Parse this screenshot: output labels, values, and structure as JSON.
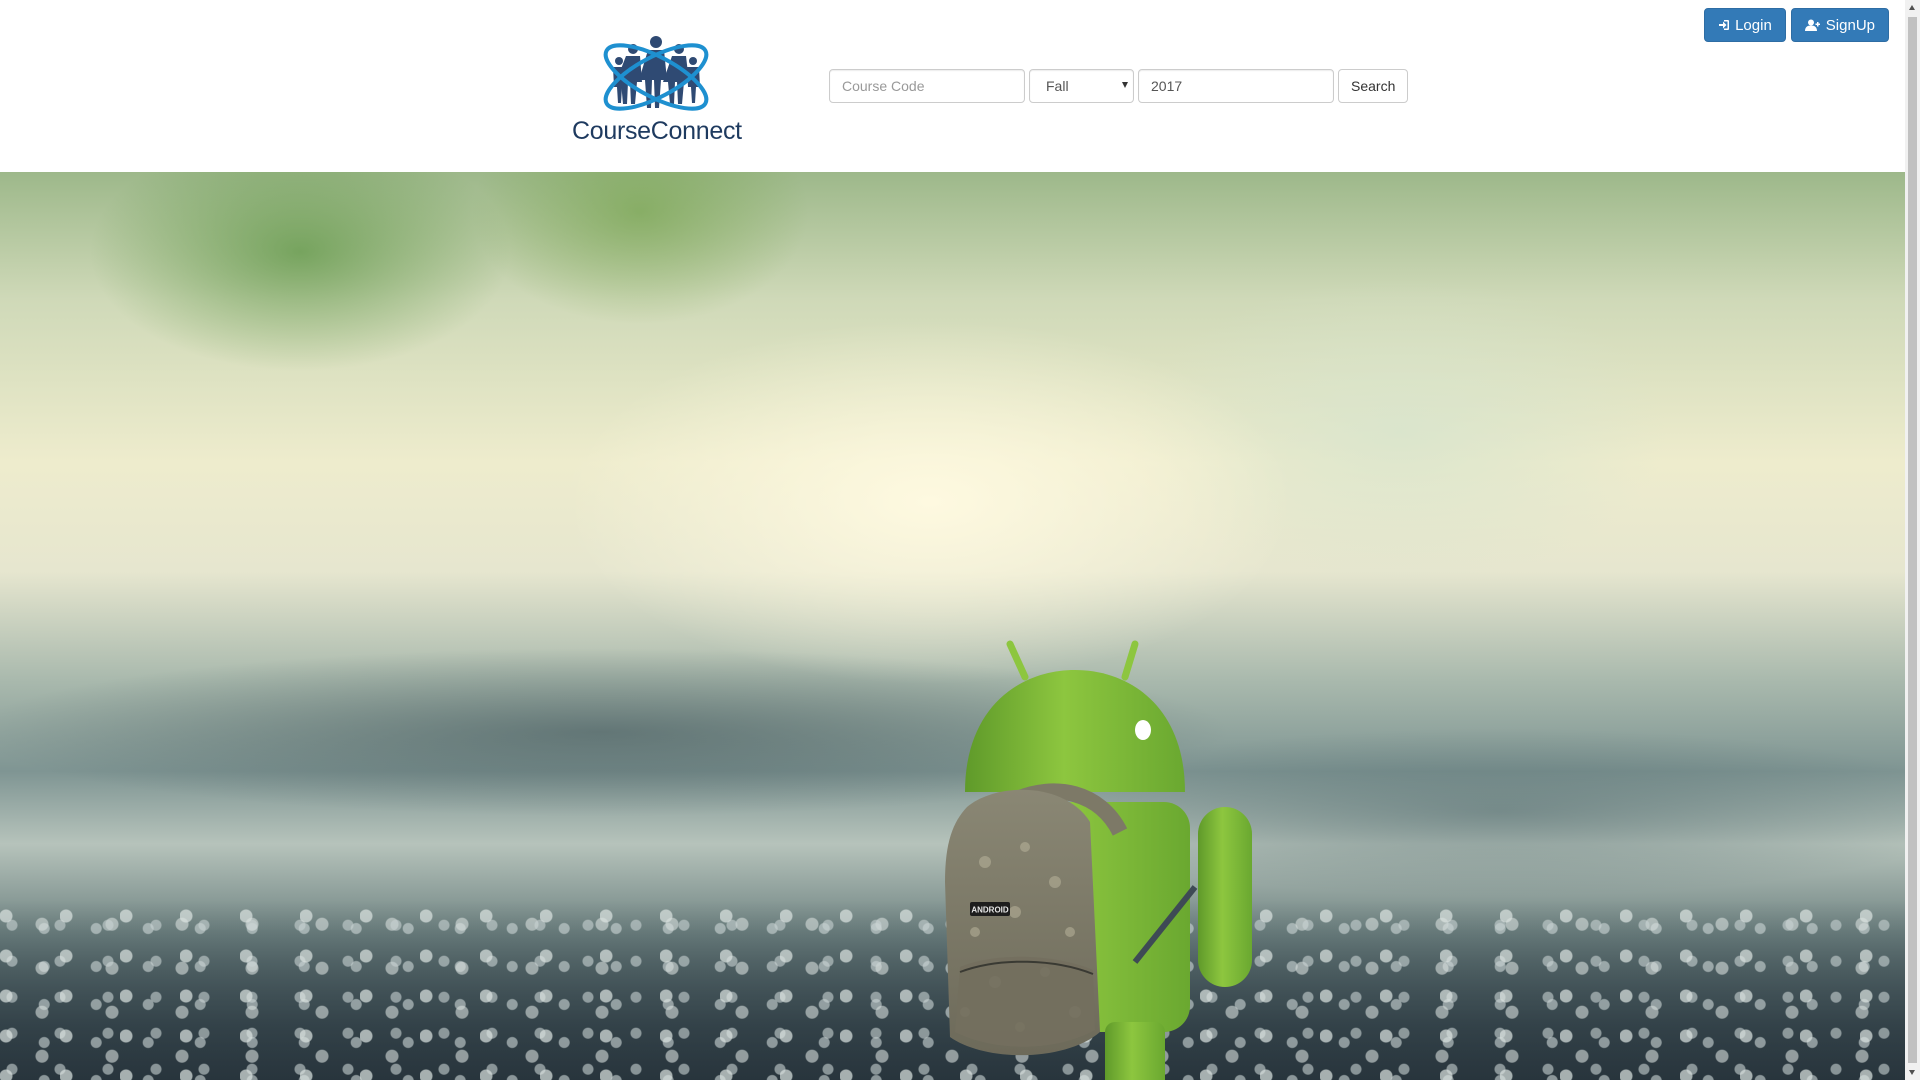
{
  "header": {
    "brand": "CourseConnect",
    "login_label": "Login",
    "signup_label": "SignUp"
  },
  "search": {
    "course_code_placeholder": "Course Code",
    "course_code_value": "",
    "term_selected": "Fall",
    "year_value": "2017",
    "search_label": "Search"
  },
  "hero": {
    "backpack_text": "ANDROID"
  },
  "icons": {
    "login": "sign-in-icon",
    "signup": "user-plus-icon",
    "select": "chevron-down-icon"
  },
  "colors": {
    "primary": "#337ab7",
    "android_green": "#8bc34a",
    "brand_blue": "#1e3a5f",
    "orbit_blue": "#1e90d0"
  }
}
